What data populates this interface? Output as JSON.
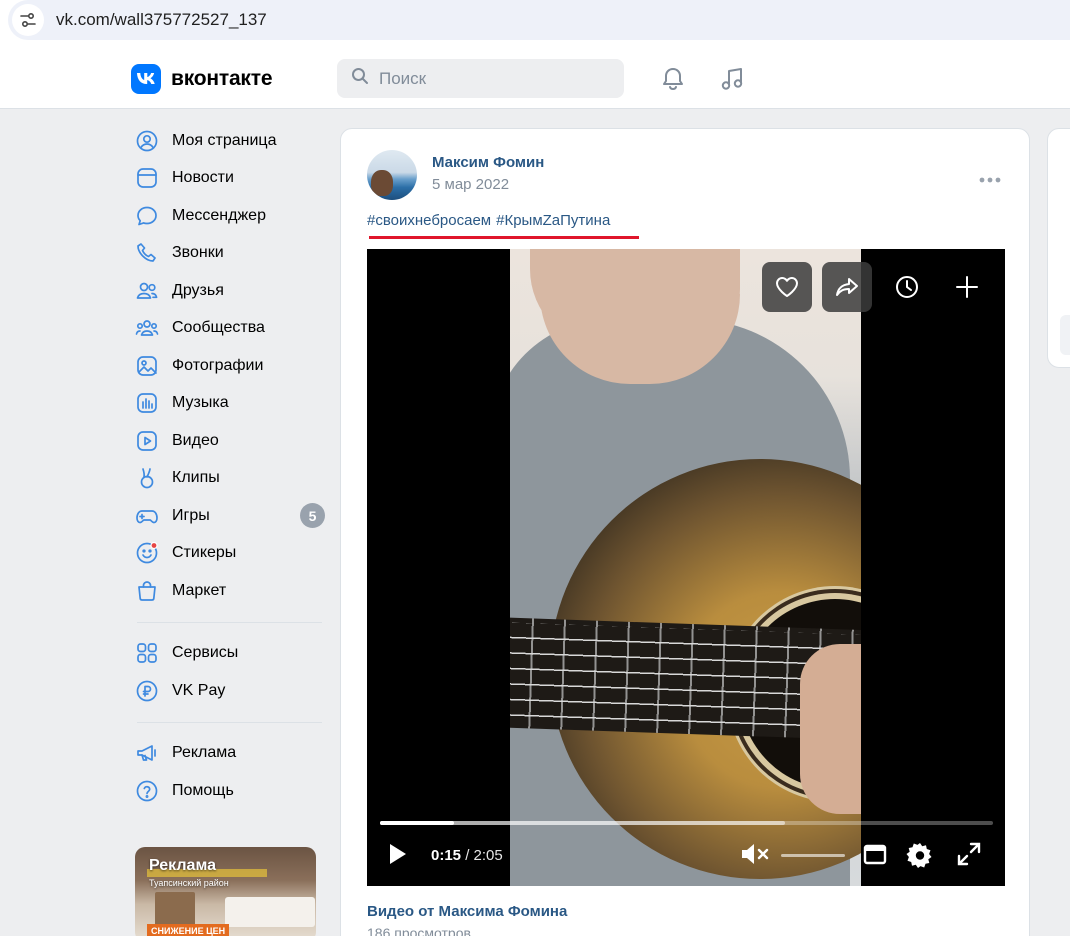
{
  "browser": {
    "url": "vk.com/wall375772527_137"
  },
  "header": {
    "logo_text": "вконтакте",
    "search_placeholder": "Поиск"
  },
  "sidebar": {
    "items": [
      {
        "label": "Моя страница",
        "icon": "user-circle-icon"
      },
      {
        "label": "Новости",
        "icon": "news-icon"
      },
      {
        "label": "Мессенджер",
        "icon": "message-icon"
      },
      {
        "label": "Звонки",
        "icon": "phone-icon"
      },
      {
        "label": "Друзья",
        "icon": "friends-icon"
      },
      {
        "label": "Сообщества",
        "icon": "communities-icon"
      },
      {
        "label": "Фотографии",
        "icon": "photos-icon"
      },
      {
        "label": "Музыка",
        "icon": "music-icon"
      },
      {
        "label": "Видео",
        "icon": "video-icon"
      },
      {
        "label": "Клипы",
        "icon": "clips-icon"
      },
      {
        "label": "Игры",
        "icon": "games-icon",
        "badge": "5"
      },
      {
        "label": "Стикеры",
        "icon": "stickers-icon"
      },
      {
        "label": "Маркет",
        "icon": "market-icon"
      }
    ],
    "items2": [
      {
        "label": "Сервисы",
        "icon": "services-icon"
      },
      {
        "label": "VK Pay",
        "icon": "vkpay-icon"
      }
    ],
    "items3": [
      {
        "label": "Реклама",
        "icon": "ads-icon"
      },
      {
        "label": "Помощь",
        "icon": "help-icon"
      }
    ],
    "ad": {
      "title": "Реклама",
      "subtitle": "Туапсинский район",
      "badge": "СНИЖЕНИЕ ЦЕН"
    }
  },
  "post": {
    "author": "Максим Фомин",
    "date": "5 мар 2022",
    "tags": [
      "#своихнебросаем",
      "#КрымZaПутина"
    ],
    "video": {
      "current_time": "0:15",
      "duration": "2:05",
      "progress": 0.12
    },
    "video_title": "Видео от Максима Фомина",
    "views": "186 просмотров"
  },
  "colors": {
    "accent": "#0077ff",
    "link": "#2a5885",
    "underline": "#e0162b"
  }
}
